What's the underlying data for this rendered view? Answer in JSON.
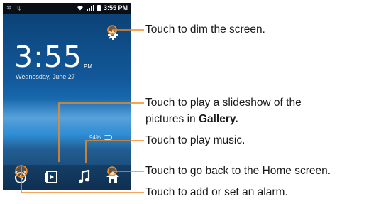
{
  "status_bar": {
    "time": "3:55 PM",
    "left_icons": [
      "usb-icon",
      "debug-icon"
    ],
    "right_icons": [
      "wifi-icon",
      "signal-icon",
      "battery-icon"
    ]
  },
  "lock_screen": {
    "clock_time": "3:55",
    "clock_period": "PM",
    "date": "Wednesday, June 27",
    "battery_percent": "94%",
    "dim_icon": "gear-icon",
    "dock": [
      {
        "name": "alarm",
        "icon": "alarm-clock-icon"
      },
      {
        "name": "gallery",
        "icon": "slideshow-icon"
      },
      {
        "name": "music",
        "icon": "music-note-icon"
      },
      {
        "name": "home",
        "icon": "home-icon"
      }
    ]
  },
  "callouts": {
    "dim": "Touch to dim the screen.",
    "gallery_line1": "Touch to play a slideshow of the",
    "gallery_line2_prefix": "pictures in ",
    "gallery_line2_bold": "Gallery.",
    "music": "Touch to play music.",
    "home": "Touch to go back to the Home screen.",
    "alarm": "Touch to add or set an alarm."
  },
  "colors": {
    "callout_line": "#f08a24",
    "label_text": "#1a1a1a",
    "status_bar": "#0a0f16"
  }
}
